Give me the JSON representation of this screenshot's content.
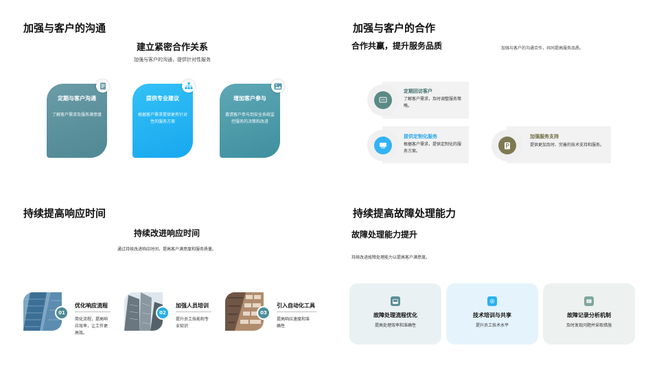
{
  "slide1": {
    "title": "加强与客户的沟通",
    "subtitle": "建立紧密合作关系",
    "description": "加强与客户的沟通，提供针对性服务",
    "cards": [
      {
        "title": "定期与客户沟通",
        "desc": "了解客户需求及服务满意度",
        "icon": "document-icon"
      },
      {
        "title": "提供专业建议",
        "desc": "根据客户需求提供更有针对性的服务方案",
        "icon": "org-chart-icon"
      },
      {
        "title": "增加客户参与",
        "desc": "邀请客户参与到安全系统监控服务的决策和改进",
        "icon": "image-icon"
      }
    ]
  },
  "slide2": {
    "title": "加强与客户的合作",
    "subtitle": "合作共赢，提升服务品质",
    "description": "加强与客户的沟通合作，共同提高服务品质。",
    "items": [
      {
        "title": "定期回访客户",
        "desc": "了解客户需求，及时调整服务策略。",
        "icon": "chat-icon",
        "color": "#5b8a86"
      },
      {
        "title": "提供定制化服务",
        "desc": "根据客户需求，提供定制化的服务方案。",
        "icon": "monitor-icon",
        "color": "#33b3f4"
      },
      {
        "title": "加强服务支持",
        "desc": "提供更加及时、完善的技术支持和服务。",
        "icon": "parking-icon",
        "color": "#7d7a52"
      }
    ]
  },
  "slide3": {
    "title": "持续提高响应时间",
    "subtitle": "持续改进响应时间",
    "description": "通过持续改进响应时间，提高客户满意度和服务质量。",
    "steps": [
      {
        "num": "01",
        "title": "优化响应流程",
        "desc": "简化流程，提高响应效率，让工作更高效。",
        "color": "#4f8a94"
      },
      {
        "num": "02",
        "title": "加强人员培训",
        "desc": "提升员工技能和专业知识",
        "color": "#28aee8"
      },
      {
        "num": "03",
        "title": "引入自动化工具",
        "desc": "提高响应速度和准确性",
        "color": "#4d8f9a"
      }
    ]
  },
  "slide4": {
    "title": "持续提高故障处理能力",
    "subtitle": "故障处理能力提升",
    "description": "持续改进故障处理能力以提高客户满意度。",
    "cards": [
      {
        "title": "故障处理流程优化",
        "desc": "提高处理效率和准确性",
        "icon": "inbox-icon",
        "bg": "#eaf1f3",
        "iconColor": "#5b8f98"
      },
      {
        "title": "技术培训与共享",
        "desc": "提升员工技术水平",
        "icon": "gear-icon",
        "bg": "#e5f4fc",
        "iconColor": "#29b2f0"
      },
      {
        "title": "故障记录分析机制",
        "desc": "及时发现问题并采取措施",
        "icon": "message-icon",
        "bg": "#edf1ef",
        "iconColor": "#7ea69e"
      }
    ]
  }
}
